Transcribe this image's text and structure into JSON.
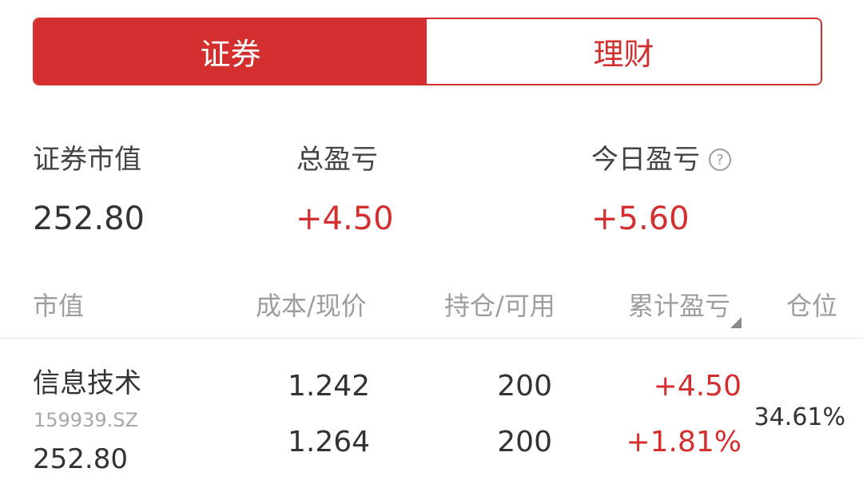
{
  "tabs": [
    {
      "label": "证券",
      "active": true
    },
    {
      "label": "理财",
      "active": false
    }
  ],
  "summary": {
    "market_value_label": "证券市值",
    "market_value": "252.80",
    "total_pl_label": "总盈亏",
    "total_pl": "+4.50",
    "today_pl_label": "今日盈亏",
    "today_pl": "+5.60",
    "help_icon": "question-circle-icon"
  },
  "table": {
    "headers": {
      "market_value": "市值",
      "cost_price": "成本/现价",
      "holding_available": "持仓/可用",
      "cumulative_pl": "累计盈亏",
      "position": "仓位"
    },
    "rows": [
      {
        "name": "信息技术",
        "code": "159939.SZ",
        "market_value": "252.80",
        "cost": "1.242",
        "price": "1.264",
        "holding": "200",
        "available": "200",
        "pl_amount": "+4.50",
        "pl_percent": "+1.81%",
        "position": "34.61%"
      }
    ]
  },
  "colors": {
    "accent": "#d32f2f",
    "text": "#333333",
    "muted": "#9e9e9e",
    "divider": "#e6e6e6"
  }
}
